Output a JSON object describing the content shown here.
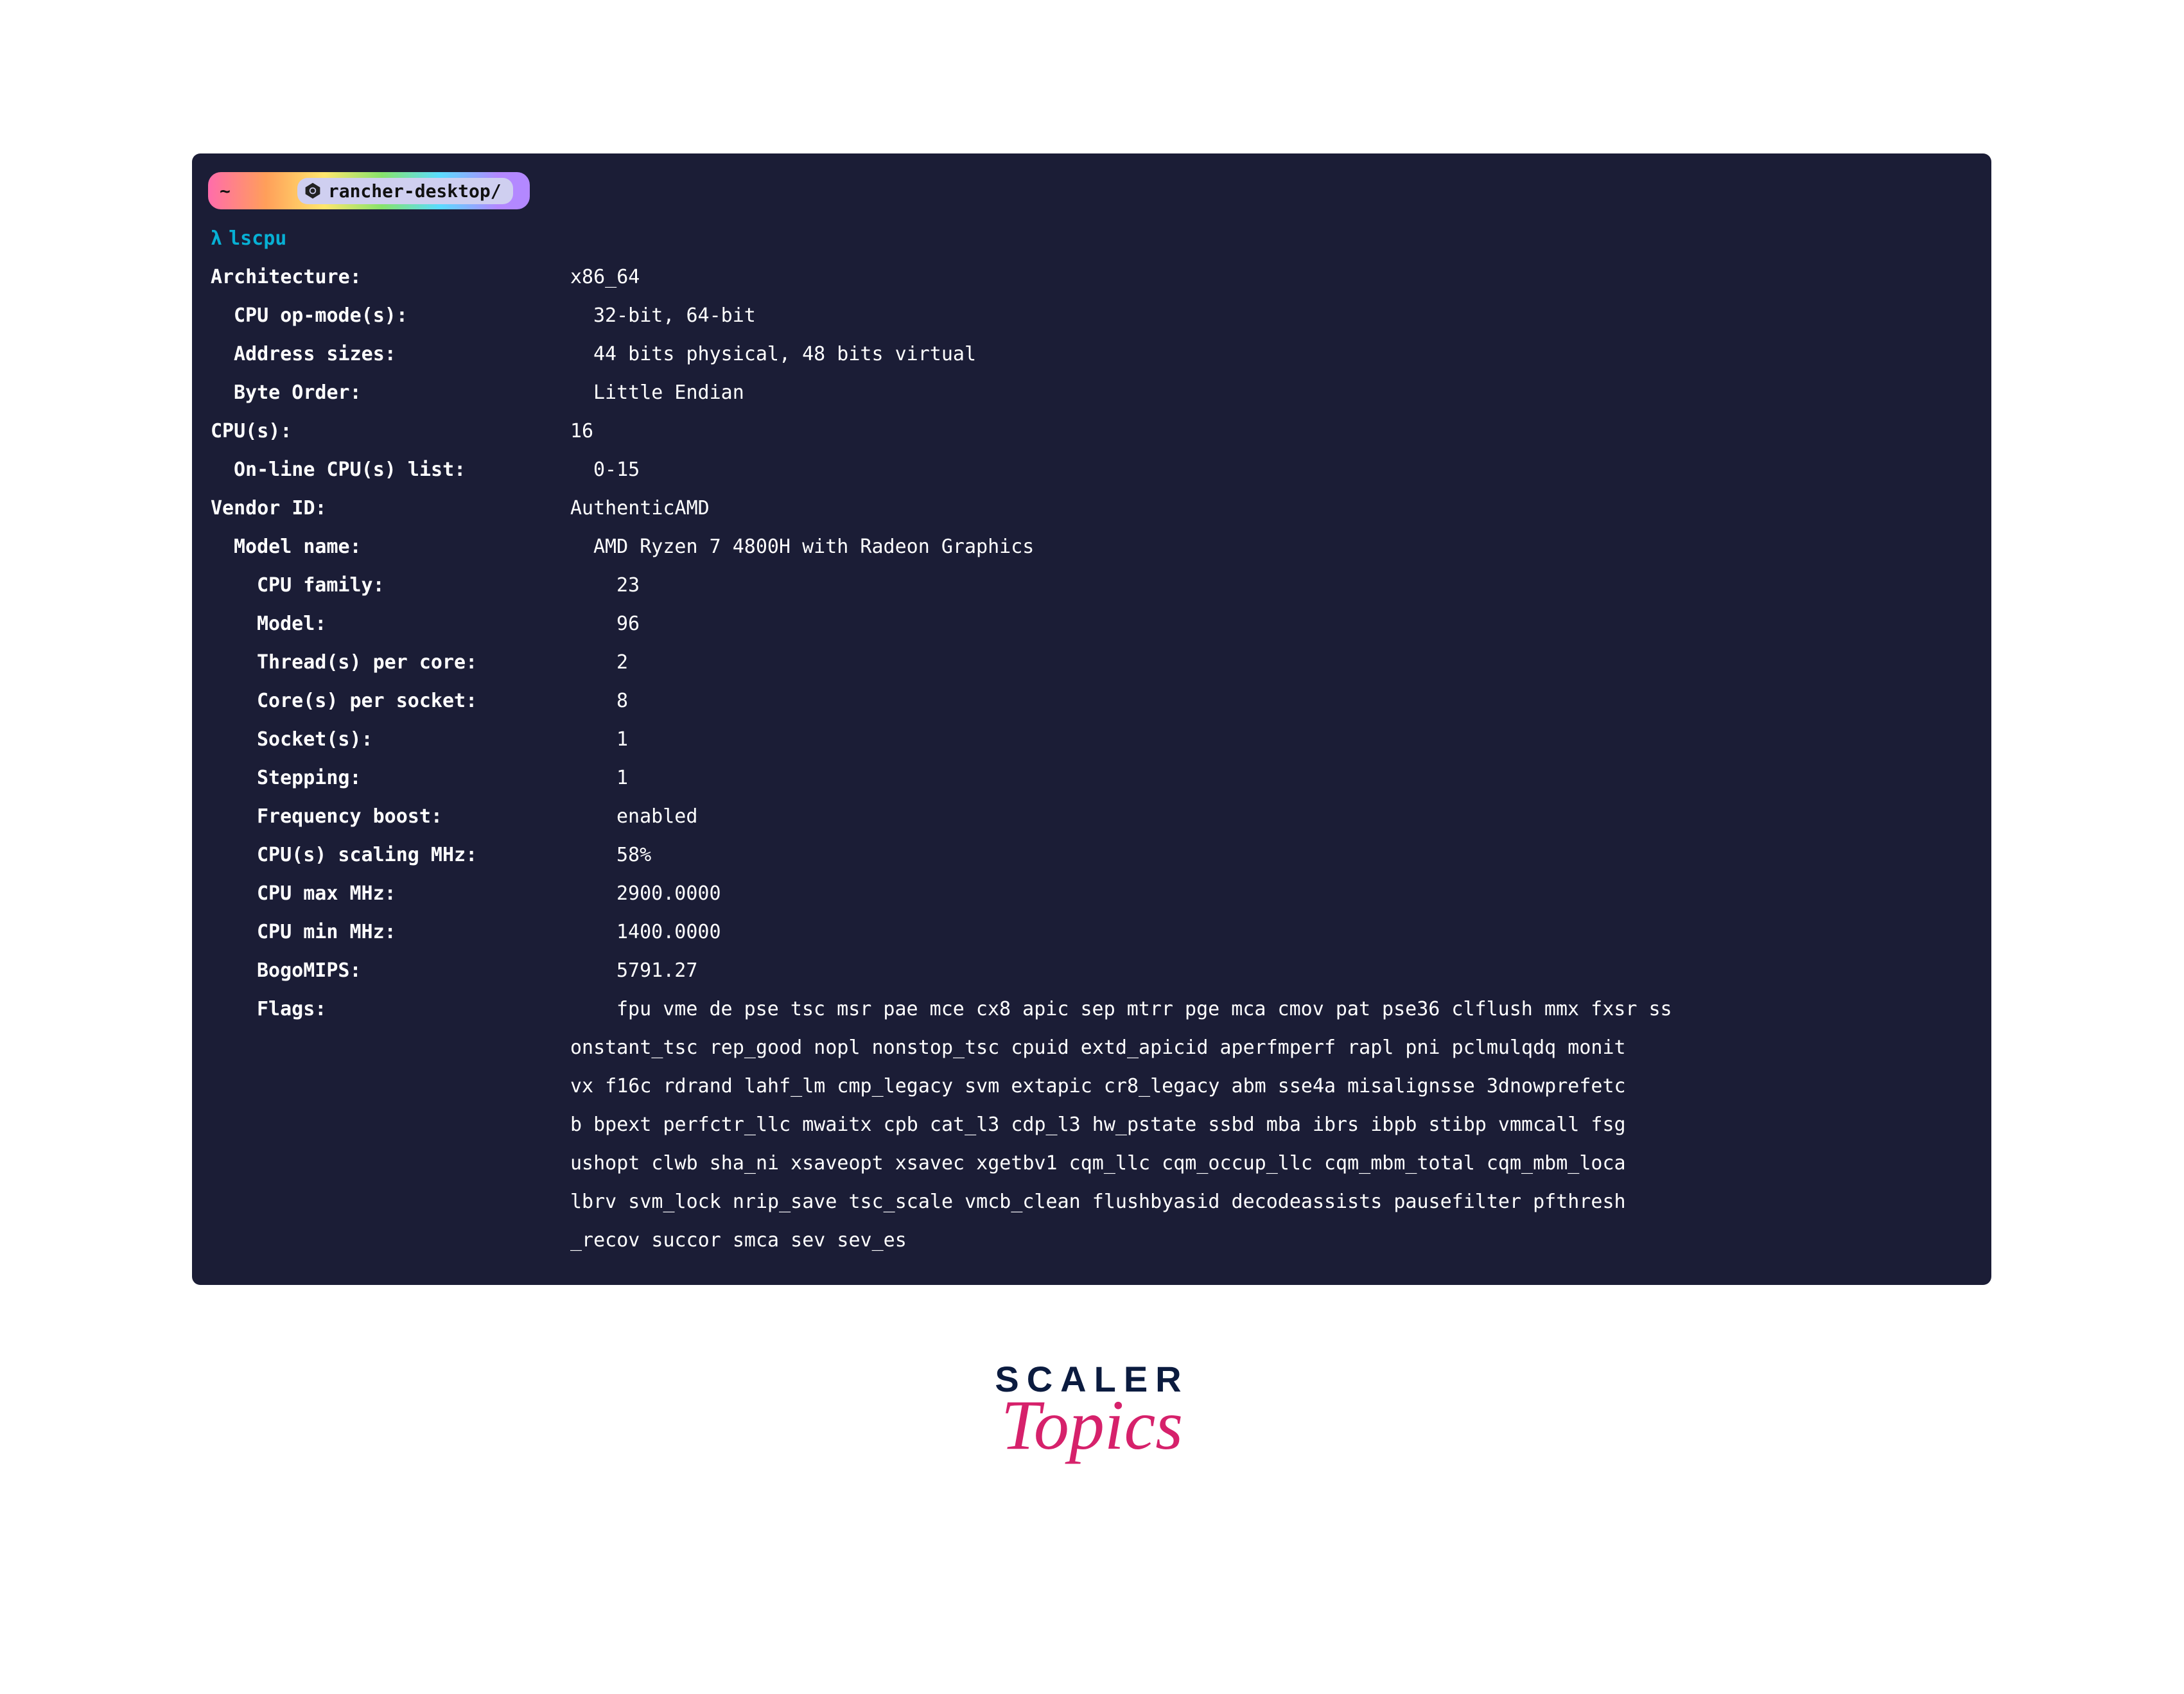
{
  "tab": {
    "home_glyph": "~",
    "context_label": "rancher-desktop/"
  },
  "prompt": {
    "lambda": "λ",
    "command": "lscpu"
  },
  "rows": [
    {
      "indent": 0,
      "label": "Architecture:",
      "value": "x86_64"
    },
    {
      "indent": 1,
      "label": "CPU op-mode(s):",
      "value": "32-bit, 64-bit"
    },
    {
      "indent": 1,
      "label": "Address sizes:",
      "value": "44 bits physical, 48 bits virtual"
    },
    {
      "indent": 1,
      "label": "Byte Order:",
      "value": "Little Endian"
    },
    {
      "indent": 0,
      "label": "CPU(s):",
      "value": "16"
    },
    {
      "indent": 1,
      "label": "On-line CPU(s) list:",
      "value": "0-15"
    },
    {
      "indent": 0,
      "label": "Vendor ID:",
      "value": "AuthenticAMD"
    },
    {
      "indent": 1,
      "label": "Model name:",
      "value": "AMD Ryzen 7 4800H with Radeon Graphics"
    },
    {
      "indent": 2,
      "label": "CPU family:",
      "value": "23"
    },
    {
      "indent": 2,
      "label": "Model:",
      "value": "96"
    },
    {
      "indent": 2,
      "label": "Thread(s) per core:",
      "value": "2"
    },
    {
      "indent": 2,
      "label": "Core(s) per socket:",
      "value": "8"
    },
    {
      "indent": 2,
      "label": "Socket(s):",
      "value": "1"
    },
    {
      "indent": 2,
      "label": "Stepping:",
      "value": "1"
    },
    {
      "indent": 2,
      "label": "Frequency boost:",
      "value": "enabled"
    },
    {
      "indent": 2,
      "label": "CPU(s) scaling MHz:",
      "value": "58%"
    },
    {
      "indent": 2,
      "label": "CPU max MHz:",
      "value": "2900.0000"
    },
    {
      "indent": 2,
      "label": "CPU min MHz:",
      "value": "1400.0000"
    },
    {
      "indent": 2,
      "label": "BogoMIPS:",
      "value": "5791.27"
    }
  ],
  "flags": {
    "label": "Flags:",
    "first": "fpu vme de pse tsc msr pae mce cx8 apic sep mtrr pge mca cmov pat pse36 clflush mmx fxsr ss",
    "cont": [
      "onstant_tsc rep_good nopl nonstop_tsc cpuid extd_apicid aperfmperf rapl pni pclmulqdq monit",
      "vx f16c rdrand lahf_lm cmp_legacy svm extapic cr8_legacy abm sse4a misalignsse 3dnowprefetc",
      "b bpext perfctr_llc mwaitx cpb cat_l3 cdp_l3 hw_pstate ssbd mba ibrs ibpb stibp vmmcall fsg",
      "ushopt clwb sha_ni xsaveopt xsavec xgetbv1 cqm_llc cqm_occup_llc cqm_mbm_total cqm_mbm_loca",
      "lbrv svm_lock nrip_save tsc_scale vmcb_clean flushbyasid decodeassists pausefilter pfthresh",
      "_recov succor smca sev sev_es"
    ]
  },
  "logo": {
    "line1": "SCALER",
    "line2": "Topics"
  }
}
